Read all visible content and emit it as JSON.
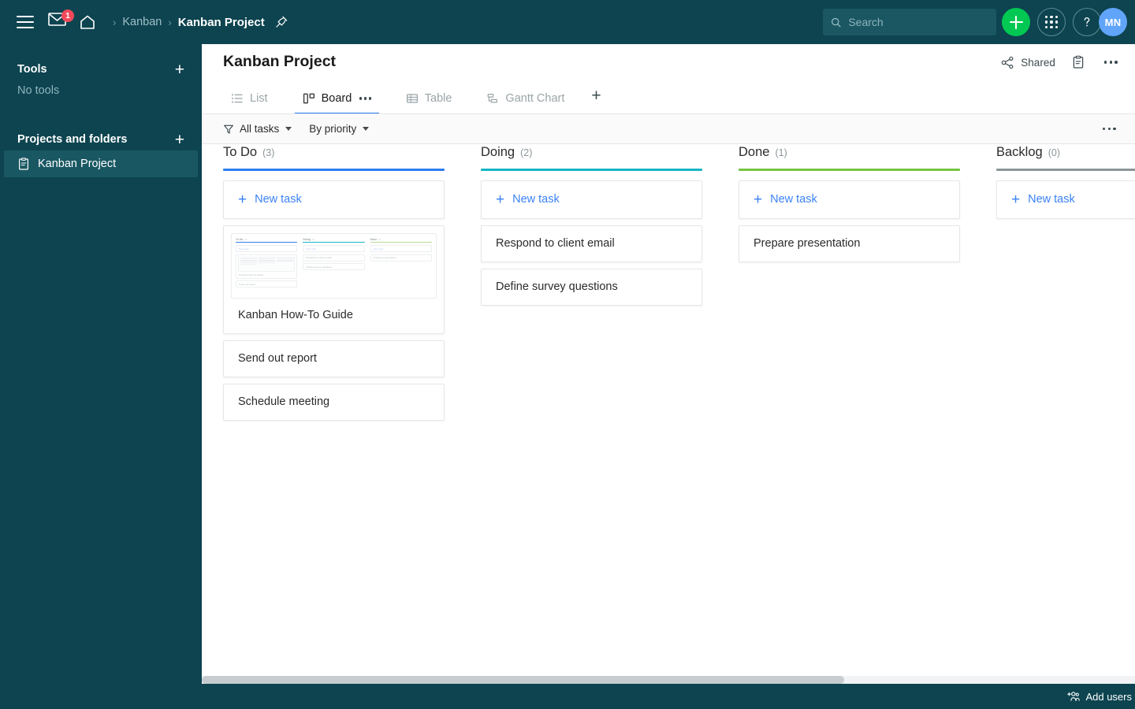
{
  "topbar": {
    "menu_icon": "hamburger-icon",
    "mail_icon": "mail-icon",
    "mail_badge": "1",
    "home_icon": "home-icon",
    "breadcrumb": {
      "parent": "Kanban",
      "separator": "›",
      "current": "Kanban Project"
    },
    "pin_icon": "pin-icon",
    "search": {
      "placeholder": "Search",
      "value": "",
      "icon": "search-icon"
    },
    "create_button_label": "+",
    "apps_icon": "apps-grid-icon",
    "help_icon": "help-circle-icon",
    "avatar_initials": "MN"
  },
  "sidebar": {
    "tools": {
      "title": "Tools",
      "add_label": "+",
      "empty_text": "No tools"
    },
    "projects": {
      "title": "Projects and folders",
      "add_label": "+",
      "items": [
        {
          "label": "Kanban Project",
          "icon": "clipboard-icon",
          "active": true
        }
      ]
    }
  },
  "content_header": {
    "title": "Kanban Project",
    "shared_label": "Shared",
    "share_icon": "share-nodes-icon",
    "clipboard_icon": "clipboard-icon",
    "more_icon": "more-horizontal-icon"
  },
  "tabs": {
    "items": [
      {
        "label": "List",
        "icon": "list-icon",
        "active": false,
        "has_dots": false
      },
      {
        "label": "Board",
        "icon": "board-icon",
        "active": true,
        "has_dots": true
      },
      {
        "label": "Table",
        "icon": "table-icon",
        "active": false,
        "has_dots": false
      },
      {
        "label": "Gantt Chart",
        "icon": "gantt-icon",
        "active": false,
        "has_dots": false
      }
    ],
    "add_label": "+"
  },
  "filterbar": {
    "filter_icon": "funnel-icon",
    "filters": [
      {
        "label": "All tasks",
        "has_chevron": true
      },
      {
        "label": "By priority",
        "has_chevron": true
      }
    ],
    "more_icon": "more-horizontal-icon"
  },
  "board": {
    "new_task_label": "New task",
    "columns": [
      {
        "name": "To Do",
        "count": "(3)",
        "color": "#2f7ef0",
        "cards": [
          {
            "title": "Kanban How-To Guide",
            "has_media": true
          },
          {
            "title": "Send out report",
            "has_media": false
          },
          {
            "title": "Schedule meeting",
            "has_media": false
          }
        ]
      },
      {
        "name": "Doing",
        "count": "(2)",
        "color": "#17b6c4",
        "cards": [
          {
            "title": "Respond to client email",
            "has_media": false
          },
          {
            "title": "Define survey questions",
            "has_media": false
          }
        ]
      },
      {
        "name": "Done",
        "count": "(1)",
        "color": "#76c442",
        "cards": [
          {
            "title": "Prepare presentation",
            "has_media": false
          }
        ]
      },
      {
        "name": "Backlog",
        "count": "(0)",
        "color": "#8d9699",
        "cards": []
      }
    ],
    "media_preview": {
      "new_task_label": "New task",
      "columns": [
        {
          "name": "To Do",
          "count": "(3)",
          "color": "#2f7ef0",
          "cards": [
            "Kanban How-To Guide",
            "Send out report"
          ]
        },
        {
          "name": "Doing",
          "count": "(2)",
          "color": "#17b6c4",
          "cards": [
            "Respond to client email",
            "Define survey questions"
          ]
        },
        {
          "name": "Done",
          "count": "(1)",
          "color": "#76c442",
          "cards": [
            "Prepare presentation"
          ]
        }
      ]
    }
  },
  "bottombar": {
    "add_users_label": "Add users",
    "add_users_icon": "add-users-icon"
  }
}
